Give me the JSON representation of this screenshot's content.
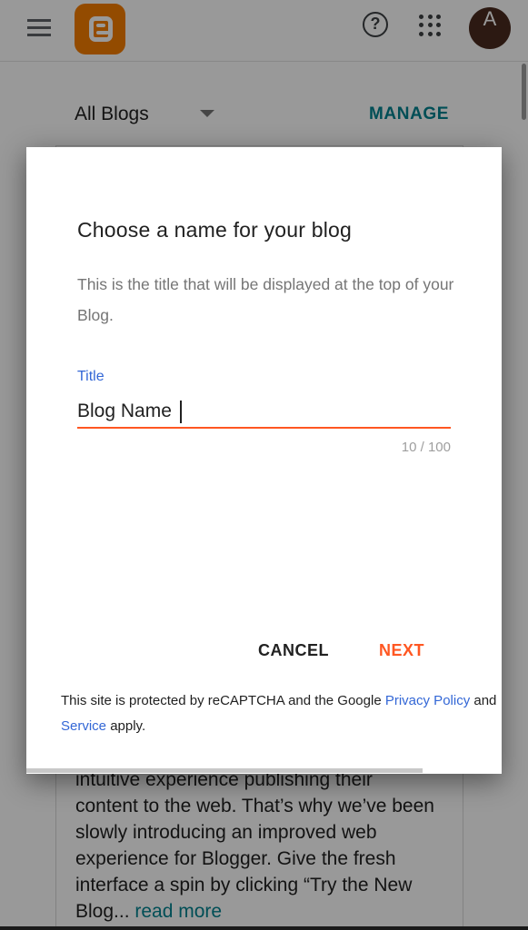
{
  "header": {
    "avatar_letter": "A",
    "help_glyph": "?"
  },
  "blogs": {
    "selector_label": "All Blogs",
    "manage_label": "MANAGE"
  },
  "background_card": {
    "text": "intuitive experience publishing their content to the web. That’s why we’ve been slowly introducing an improved web experience for Blogger. Give the fresh interface a spin by clicking “Try the New Blog... ",
    "read_more": "read more"
  },
  "dialog": {
    "title": "Choose a name for your blog",
    "description": "This is the title that will be displayed at the top of your Blog.",
    "field_label": "Title",
    "field_value": "Blog Name",
    "char_count": "10 / 100",
    "cancel_label": "CANCEL",
    "next_label": "NEXT",
    "recaptcha_prefix": "This site is protected by reCAPTCHA and the Google ",
    "privacy_link": "Privacy Policy",
    "recaptcha_middle": " and ",
    "terms_link": "Service",
    "recaptcha_suffix": " apply."
  },
  "colors": {
    "brand": "#f57d00",
    "accent": "#ff5722",
    "link": "#3367d6",
    "manage": "#00838f"
  },
  "icons": [
    "menu-icon",
    "blogger-logo-icon",
    "help-icon",
    "apps-icon",
    "dropdown-arrow-icon"
  ]
}
